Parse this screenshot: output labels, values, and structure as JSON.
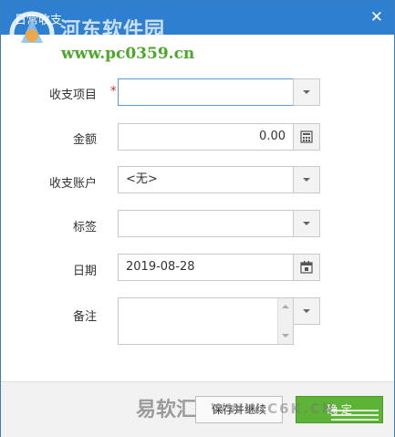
{
  "window": {
    "title": "日常收支",
    "close_glyph": "✕"
  },
  "watermark": {
    "site_name": "河东软件园",
    "site_url": "www.pc0359.cn",
    "bottom_brand": "易软汇",
    "bottom_url": "WWW.C6K.CN"
  },
  "form": {
    "item": {
      "label": "收支项目",
      "required_mark": "*",
      "value": ""
    },
    "amount": {
      "label": "金额",
      "value": "0.00"
    },
    "account": {
      "label": "收支账户",
      "value": "<无>"
    },
    "tag": {
      "label": "标签",
      "value": ""
    },
    "date": {
      "label": "日期",
      "value": "2019-08-28"
    },
    "note": {
      "label": "备注",
      "value": ""
    }
  },
  "buttons": {
    "save_continue": "保存并继续",
    "ok": "确 定"
  },
  "colors": {
    "titlebar": "#2f7fd0",
    "ok_button": "#5cb336",
    "required": "#d22222"
  }
}
